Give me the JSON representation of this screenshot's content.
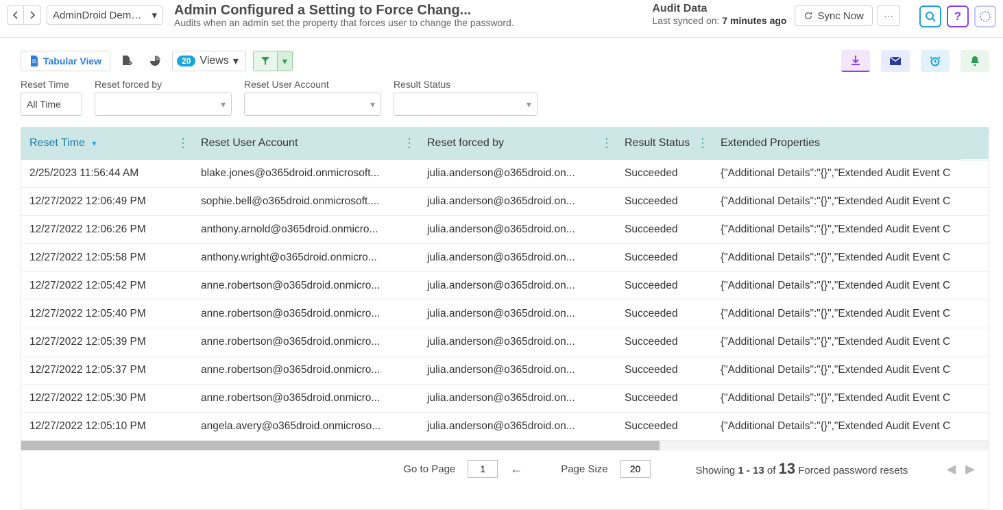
{
  "header": {
    "tenant_dropdown": "AdminDroid Dem…",
    "title": "Admin Configured a Setting to Force Chang...",
    "subtitle": "Audits when an admin set the property that forces user to change the password.",
    "audit_label": "Audit Data",
    "synced_prefix": "Last synced on: ",
    "synced_value": "7 minutes ago",
    "sync_now": "Sync Now"
  },
  "toolbar": {
    "tabular_view": "Tabular View",
    "views_label": "Views",
    "views_count": "20"
  },
  "filters": {
    "reset_time_label": "Reset Time",
    "reset_time_value": "All Time",
    "forced_by_label": "Reset forced by",
    "user_account_label": "Reset User Account",
    "result_status_label": "Result Status"
  },
  "table": {
    "columns": {
      "reset_time": "Reset Time",
      "reset_user": "Reset User Account",
      "forced_by": "Reset forced by",
      "result_status": "Result Status",
      "extended": "Extended Properties"
    },
    "rows": [
      {
        "time": "2/25/2023 11:56:44 AM",
        "user": "blake.jones@o365droid.onmicrosoft...",
        "by": "julia.anderson@o365droid.on...",
        "status": "Succeeded",
        "ext": "{\"Additional Details\":\"{}\",\"Extended Audit Event C"
      },
      {
        "time": "12/27/2022 12:06:49 PM",
        "user": "sophie.bell@o365droid.onmicrosoft....",
        "by": "julia.anderson@o365droid.on...",
        "status": "Succeeded",
        "ext": "{\"Additional Details\":\"{}\",\"Extended Audit Event C"
      },
      {
        "time": "12/27/2022 12:06:26 PM",
        "user": "anthony.arnold@o365droid.onmicro...",
        "by": "julia.anderson@o365droid.on...",
        "status": "Succeeded",
        "ext": "{\"Additional Details\":\"{}\",\"Extended Audit Event C"
      },
      {
        "time": "12/27/2022 12:05:58 PM",
        "user": "anthony.wright@o365droid.onmicro...",
        "by": "julia.anderson@o365droid.on...",
        "status": "Succeeded",
        "ext": "{\"Additional Details\":\"{}\",\"Extended Audit Event C"
      },
      {
        "time": "12/27/2022 12:05:42 PM",
        "user": "anne.robertson@o365droid.onmicro...",
        "by": "julia.anderson@o365droid.on...",
        "status": "Succeeded",
        "ext": "{\"Additional Details\":\"{}\",\"Extended Audit Event C"
      },
      {
        "time": "12/27/2022 12:05:40 PM",
        "user": "anne.robertson@o365droid.onmicro...",
        "by": "julia.anderson@o365droid.on...",
        "status": "Succeeded",
        "ext": "{\"Additional Details\":\"{}\",\"Extended Audit Event C"
      },
      {
        "time": "12/27/2022 12:05:39 PM",
        "user": "anne.robertson@o365droid.onmicro...",
        "by": "julia.anderson@o365droid.on...",
        "status": "Succeeded",
        "ext": "{\"Additional Details\":\"{}\",\"Extended Audit Event C"
      },
      {
        "time": "12/27/2022 12:05:37 PM",
        "user": "anne.robertson@o365droid.onmicro...",
        "by": "julia.anderson@o365droid.on...",
        "status": "Succeeded",
        "ext": "{\"Additional Details\":\"{}\",\"Extended Audit Event C"
      },
      {
        "time": "12/27/2022 12:05:30 PM",
        "user": "anne.robertson@o365droid.onmicro...",
        "by": "julia.anderson@o365droid.on...",
        "status": "Succeeded",
        "ext": "{\"Additional Details\":\"{}\",\"Extended Audit Event C"
      },
      {
        "time": "12/27/2022 12:05:10 PM",
        "user": "angela.avery@o365droid.onmicroso...",
        "by": "julia.anderson@o365droid.on...",
        "status": "Succeeded",
        "ext": "{\"Additional Details\":\"{}\",\"Extended Audit Event C"
      }
    ]
  },
  "footer": {
    "goto_label": "Go to Page",
    "goto_value": "1",
    "pagesize_label": "Page Size",
    "pagesize_value": "20",
    "showing_prefix": "Showing ",
    "range": "1 - 13",
    "of": " of ",
    "total": "13",
    "suffix": " Forced password resets"
  }
}
